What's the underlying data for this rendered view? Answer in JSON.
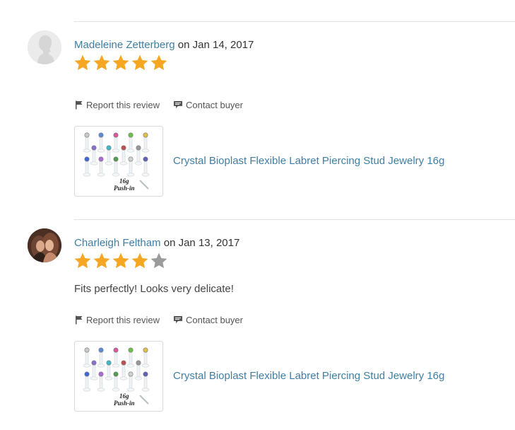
{
  "reviews": [
    {
      "reviewer": "Madeleine Zetterberg",
      "date_prefix": "on",
      "date": "Jan 14, 2017",
      "rating": 5,
      "text": "",
      "report_label": "Report this review",
      "contact_label": "Contact buyer",
      "product_title": "Crystal Bioplast Flexible Labret Piercing Stud Jewelry 16g",
      "thumb_caption_line1": "16g",
      "thumb_caption_line2": "Push-in"
    },
    {
      "reviewer": "Charleigh Feltham",
      "date_prefix": "on",
      "date": "Jan 13, 2017",
      "rating": 4,
      "text": "Fits perfectly! Looks very delicate!",
      "report_label": "Report this review",
      "contact_label": "Contact buyer",
      "product_title": "Crystal Bioplast Flexible Labret Piercing Stud Jewelry 16g",
      "thumb_caption_line1": "16g",
      "thumb_caption_line2": "Push-in"
    }
  ],
  "colors": {
    "star_filled": "#f5a623",
    "star_empty": "#9b9b9b",
    "link": "#3f7ea3"
  },
  "icons": {
    "report": "flag-icon",
    "contact": "speech-bubble-icon"
  }
}
